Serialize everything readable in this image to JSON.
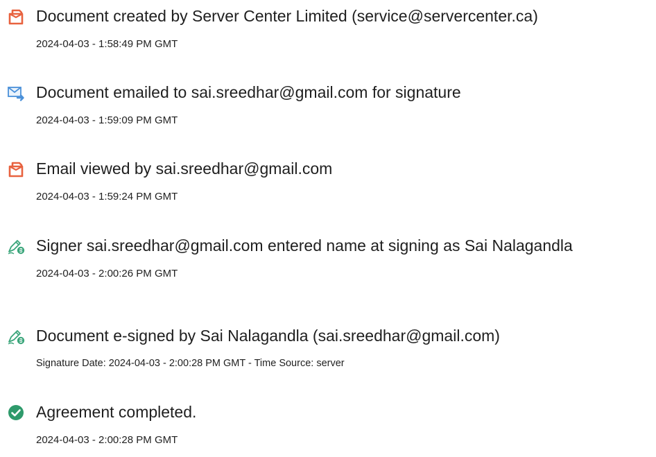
{
  "events": [
    {
      "icon": "document-created-icon",
      "title": "Document created by Server Center Limited (service@servercenter.ca)",
      "meta": "2024-04-03 - 1:58:49 PM GMT"
    },
    {
      "icon": "email-sent-icon",
      "title": "Document emailed to sai.sreedhar@gmail.com for signature",
      "meta": "2024-04-03 - 1:59:09 PM GMT"
    },
    {
      "icon": "document-viewed-icon",
      "title": "Email viewed by sai.sreedhar@gmail.com",
      "meta": "2024-04-03 - 1:59:24 PM GMT"
    },
    {
      "icon": "signer-pen-icon",
      "title": "Signer sai.sreedhar@gmail.com entered name at signing as Sai Nalagandla",
      "meta": "2024-04-03 - 2:00:26 PM GMT"
    },
    {
      "icon": "esign-pen-icon",
      "title": "Document e-signed by Sai Nalagandla (sai.sreedhar@gmail.com)",
      "meta": "Signature Date: 2024-04-03 - 2:00:28 PM GMT - Time Source: server"
    },
    {
      "icon": "checkmark-circle-icon",
      "title": "Agreement completed.",
      "meta": "2024-04-03 - 2:00:28 PM GMT"
    }
  ],
  "colors": {
    "document_icon": "#e8623f",
    "email_icon": "#4a90d9",
    "pen_icon": "#3aa57a",
    "check_icon": "#2e9a6b",
    "text": "#1f1f1f"
  }
}
